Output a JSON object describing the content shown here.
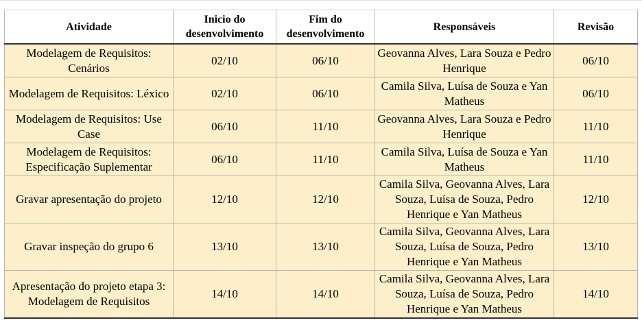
{
  "table": {
    "headers": [
      "Atividade",
      "Inicio do desenvolvimento",
      "Fim do desenvolvimento",
      "Responsáveis",
      "Revisão"
    ],
    "rows": [
      {
        "atividade": "Modelagem de Requisitos: Cenários",
        "inicio": "02/10",
        "fim": "06/10",
        "responsaveis": "Geovanna Alves, Lara Souza e Pedro Henrique",
        "revisao": "06/10"
      },
      {
        "atividade": "Modelagem de Requisitos: Léxico",
        "inicio": "02/10",
        "fim": "06/10",
        "responsaveis": "Camila Silva, Luísa de Souza e Yan Matheus",
        "revisao": "06/10"
      },
      {
        "atividade": "Modelagem de Requisitos: Use Case",
        "inicio": "06/10",
        "fim": "11/10",
        "responsaveis": "Geovanna Alves, Lara Souza e Pedro Henrique",
        "revisao": "11/10"
      },
      {
        "atividade": "Modelagem de Requisitos: Especificação Suplementar",
        "inicio": "06/10",
        "fim": "11/10",
        "responsaveis": "Camila Silva, Luísa de Souza e Yan Matheus",
        "revisao": "11/10"
      },
      {
        "atividade": "Gravar apresentação do projeto",
        "inicio": "12/10",
        "fim": "12/10",
        "responsaveis": "Camila Silva, Geovanna Alves, Lara Souza, Luísa de Souza, Pedro Henrique e Yan Matheus",
        "revisao": "12/10"
      },
      {
        "atividade": "Gravar inspeção do grupo 6",
        "inicio": "13/10",
        "fim": "13/10",
        "responsaveis": "Camila Silva, Geovanna Alves, Lara Souza, Luísa de Souza, Pedro Henrique e Yan Matheus",
        "revisao": "13/10"
      },
      {
        "atividade": "Apresentação do projeto etapa 3: Modelagem de Requisitos",
        "inicio": "14/10",
        "fim": "14/10",
        "responsaveis": "Camila Silva, Geovanna Alves, Lara Souza, Luísa de Souza, Pedro Henrique e Yan Matheus",
        "revisao": "14/10"
      }
    ]
  },
  "colors": {
    "row_fill": "#fcefc9",
    "header_fill": "#ffffff",
    "grid": "#b7b7b7",
    "rule": "#333333"
  }
}
